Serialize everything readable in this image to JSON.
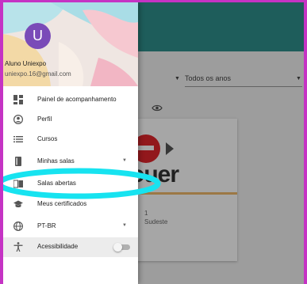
{
  "user": {
    "avatar_letter": "U",
    "name": "Aluno Uniexpo",
    "email": "uniexpo.16@gmail.com"
  },
  "menu": {
    "items": [
      {
        "label": "Painel de acompanhamento",
        "icon": "dashboard-icon"
      },
      {
        "label": "Perfil",
        "icon": "account-circle-icon"
      },
      {
        "label": "Cursos",
        "icon": "list-icon"
      },
      {
        "label": "Minhas salas",
        "icon": "book-icon",
        "has_caret": true
      },
      {
        "label": "Salas abertas",
        "icon": "open-book-icon"
      },
      {
        "label": "Meus certificados",
        "icon": "graduation-cap-icon"
      },
      {
        "label": "PT-BR",
        "icon": "globe-icon",
        "has_caret": true
      },
      {
        "label": "Acessibilidade",
        "icon": "accessibility-icon",
        "toggle": false
      }
    ]
  },
  "background": {
    "filter_year": "Todos os anos",
    "card": {
      "logo_text": "ouer",
      "line_1": "1",
      "line_2": "Sudeste"
    }
  },
  "colors": {
    "frame_border": "#c533c4",
    "header": "#2f8f8c",
    "avatar": "#7a4bb8",
    "highlight_ring": "#17e3f0"
  }
}
